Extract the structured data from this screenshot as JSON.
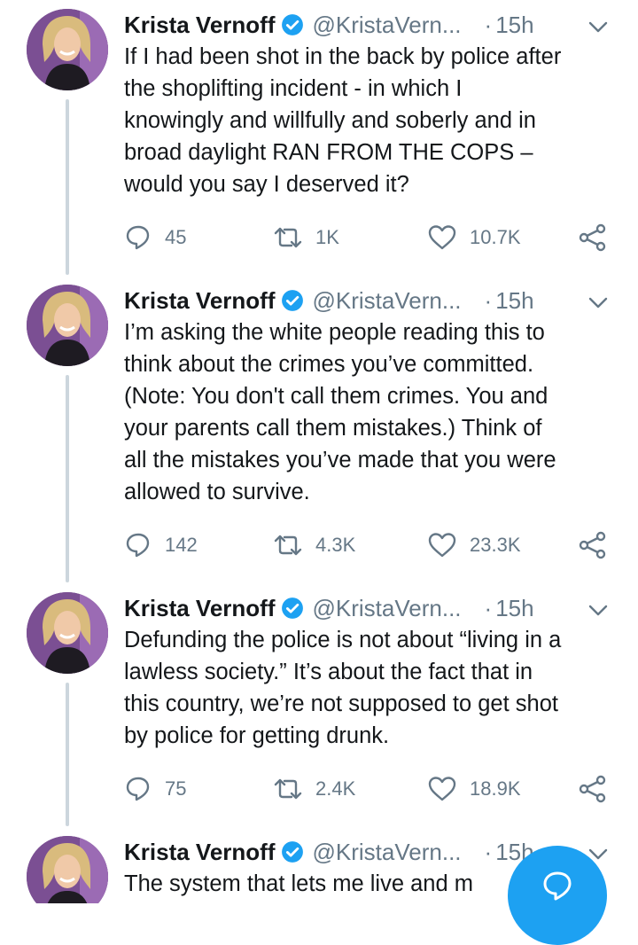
{
  "author": {
    "name": "Krista Vernoff",
    "handle": "@KristaVern...",
    "verified": true
  },
  "tweets": [
    {
      "time": "15h",
      "text": "If I had been shot in the back by police after\nthe shoplifting incident - in which I\nknowingly and willfully and soberly and in\nbroad daylight RAN FROM THE COPS –\nwould you say I deserved it?",
      "replies": "45",
      "retweets": "1K",
      "likes": "10.7K"
    },
    {
      "time": "15h",
      "text": "I’m asking the white people reading this to\nthink about the crimes you’ve committed.\n(Note: You don't call them crimes. You and\nyour parents call them mistakes.) Think of\nall the mistakes you’ve made that you were\nallowed to survive.",
      "replies": "142",
      "retweets": "4.3K",
      "likes": "23.3K"
    },
    {
      "time": "15h",
      "text": "Defunding the police is not about “living in a\nlawless society.” It’s about the fact that in\nthis country, we’re not supposed to get shot\nby police for getting drunk.",
      "replies": "75",
      "retweets": "2.4K",
      "likes": "18.9K"
    },
    {
      "time": "15h",
      "text": "The system that lets me live and m"
    }
  ],
  "icons": {
    "reply": "reply-icon",
    "retweet": "retweet-icon",
    "like": "heart-icon",
    "share": "share-icon",
    "verified": "verified-badge-icon",
    "caret": "chevron-down-icon",
    "compose": "compose-icon"
  },
  "colors": {
    "accent": "#1da1f2",
    "muted": "#657786",
    "text": "#14171a",
    "thread_line": "#ccd6dd"
  }
}
